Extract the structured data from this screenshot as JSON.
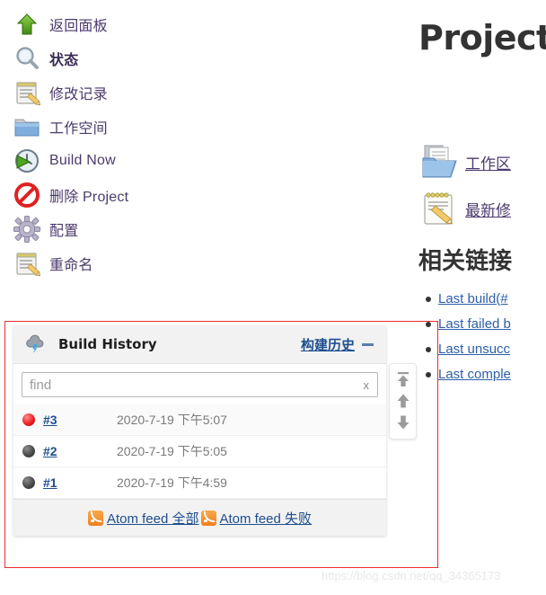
{
  "sidebar": {
    "items": [
      {
        "label": "返回面板",
        "icon": "up-arrow-icon",
        "bold": false
      },
      {
        "label": "状态",
        "icon": "magnifier-icon",
        "bold": true
      },
      {
        "label": "修改记录",
        "icon": "notepad-pencil-icon",
        "bold": false
      },
      {
        "label": "工作空间",
        "icon": "folder-icon",
        "bold": false
      },
      {
        "label": "Build Now",
        "icon": "clock-play-icon",
        "bold": false
      },
      {
        "label": "删除 Project",
        "icon": "no-entry-icon",
        "bold": false
      },
      {
        "label": "配置",
        "icon": "gear-icon",
        "bold": false
      },
      {
        "label": "重命名",
        "icon": "notepad-pencil-icon",
        "bold": false
      }
    ]
  },
  "main": {
    "project_title": "Project",
    "quick_links": [
      {
        "label": "工作区",
        "icon": "folder-documents-icon"
      },
      {
        "label": "最新修",
        "icon": "notepad-pencil-icon"
      }
    ],
    "related_heading": "相关链接",
    "related_links": [
      "Last build(#",
      "Last failed b",
      "Last unsucc",
      "Last comple"
    ]
  },
  "build_history": {
    "title": "Build History",
    "cn_link": "构建历史",
    "cloud_icon": "cloud-lightning-icon",
    "collapse_icon": "minimize-icon",
    "find": {
      "value": "",
      "placeholder": "find",
      "clear_label": "x"
    },
    "builds": [
      {
        "number": "#3",
        "date": "2020-7-19 下午5:07",
        "status": "failed",
        "status_color": "#ef2222"
      },
      {
        "number": "#2",
        "date": "2020-7-19 下午5:05",
        "status": "aborted",
        "status_color": "#4a4a4a"
      },
      {
        "number": "#1",
        "date": "2020-7-19 下午4:59",
        "status": "aborted",
        "status_color": "#4a4a4a"
      }
    ],
    "feeds": [
      {
        "label": "Atom feed 全部",
        "icon": "rss-icon"
      },
      {
        "label": "Atom feed 失败",
        "icon": "rss-icon"
      }
    ],
    "nav_buttons": [
      {
        "name": "scroll-to-top-button",
        "icon": "arrow-to-top-icon"
      },
      {
        "name": "scroll-up-button",
        "icon": "arrow-up-icon"
      },
      {
        "name": "scroll-down-button",
        "icon": "arrow-down-icon"
      }
    ]
  },
  "watermark": "https://blog.csdn.net/qq_34365173"
}
